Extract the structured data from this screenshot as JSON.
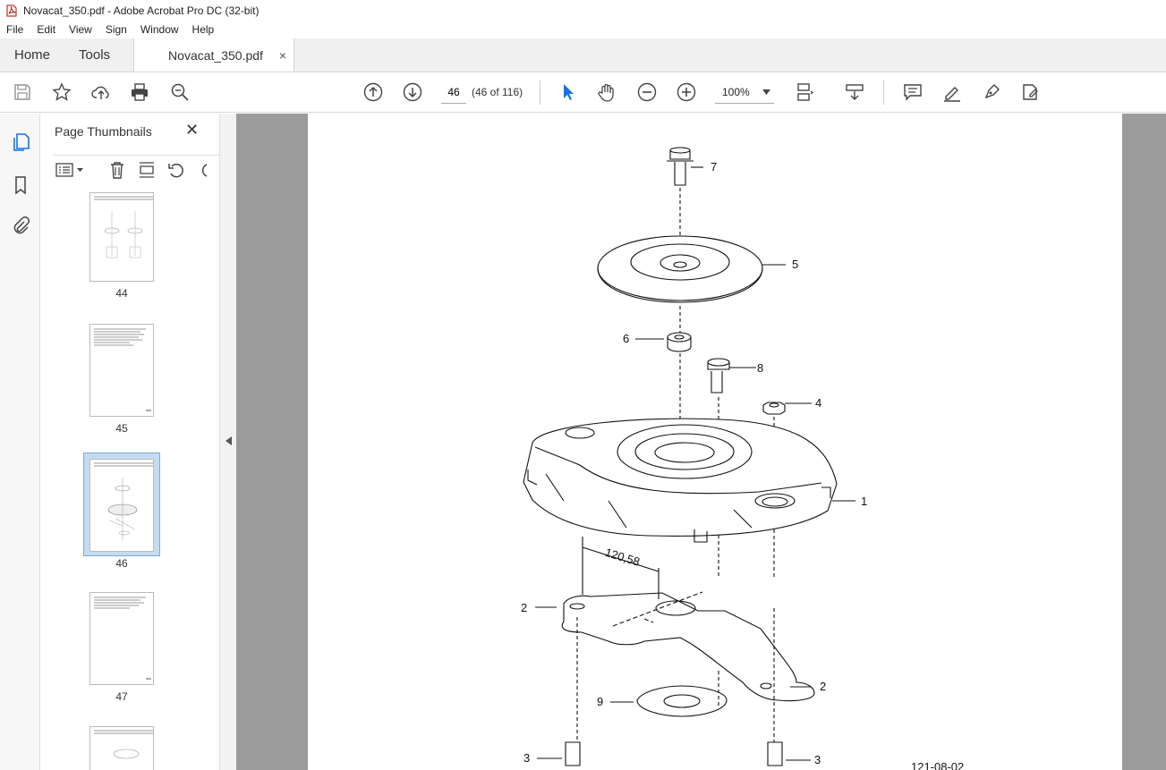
{
  "window": {
    "title": "Novacat_350.pdf - Adobe Acrobat Pro DC (32-bit)"
  },
  "menu": [
    "File",
    "Edit",
    "View",
    "Sign",
    "Window",
    "Help"
  ],
  "tabs": {
    "home": "Home",
    "tools": "Tools",
    "document": "Novacat_350.pdf",
    "close": "×"
  },
  "toolbar": {
    "page_number": "46",
    "page_count": "(46 of 116)",
    "zoom": "100%"
  },
  "thumbnails_panel": {
    "title": "Page Thumbnails",
    "close": "✕",
    "pages": [
      {
        "label": "44",
        "selected": false
      },
      {
        "label": "45",
        "selected": false
      },
      {
        "label": "46",
        "selected": true
      },
      {
        "label": "47",
        "selected": false
      }
    ]
  },
  "drawing": {
    "callouts": [
      "7",
      "5",
      "6",
      "8",
      "4",
      "1",
      "2",
      "2",
      "9",
      "3",
      "3"
    ],
    "dimension": "120,58",
    "figure_id": "121-08-02"
  }
}
